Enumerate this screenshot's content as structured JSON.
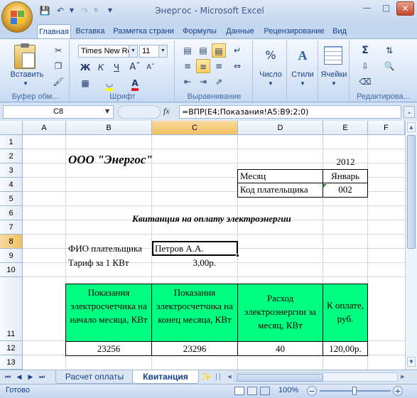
{
  "title": "Энергос - Microsoft Excel",
  "tabs": [
    "Главная",
    "Вставка",
    "Разметка страни",
    "Формулы",
    "Данные",
    "Рецензирование",
    "Вид"
  ],
  "ribbon": {
    "font_name": "Times New Ro",
    "font_size": "11",
    "paste_label": "Вставить",
    "number_label": "Число",
    "styles_label": "Стили",
    "cells_label": "Ячейки",
    "groups": [
      "Буфер обм...",
      "Шрифт",
      "Выравнивание",
      "Редактирова..."
    ],
    "bold": "Ж",
    "italic": "К",
    "underline": "Ч"
  },
  "formula_bar": {
    "name_box": "C8",
    "fx": "fx",
    "formula": "=ВПР(E4;Показания!A5:B9;2;0)"
  },
  "columns": [
    "A",
    "B",
    "C",
    "D",
    "E",
    "F"
  ],
  "rows": [
    "1",
    "2",
    "3",
    "4",
    "5",
    "6",
    "7",
    "8",
    "9",
    "10",
    "11",
    "12",
    "13"
  ],
  "cells": {
    "company": "ООО \"Энергос\"",
    "year": "2012",
    "month_label": "Месяц",
    "month_value": "Январь",
    "payer_code_label": "Код плательщика",
    "payer_code_value": "002",
    "receipt_title": "Квитанция на оплату электроэнергии",
    "fio_label": "ФИО плательщика",
    "fio_value": "Петров А.А.",
    "tariff_label": "Тариф за 1 КВт",
    "tariff_value": "3,00р."
  },
  "table": {
    "headers": [
      "Показания электросчетчика на начало месяца, КВт",
      "Показания электросчетчика на конец месяца, КВт",
      "Расход электроэнергии за месяц, КВт",
      "К оплате, руб."
    ],
    "row": [
      "23256",
      "23296",
      "40",
      "120,00р."
    ]
  },
  "sheet_tabs": [
    "Расчет оплаты",
    "Квитанция"
  ],
  "active_sheet": "Квитанция",
  "status": {
    "ready": "Готово",
    "zoom": "100%"
  }
}
